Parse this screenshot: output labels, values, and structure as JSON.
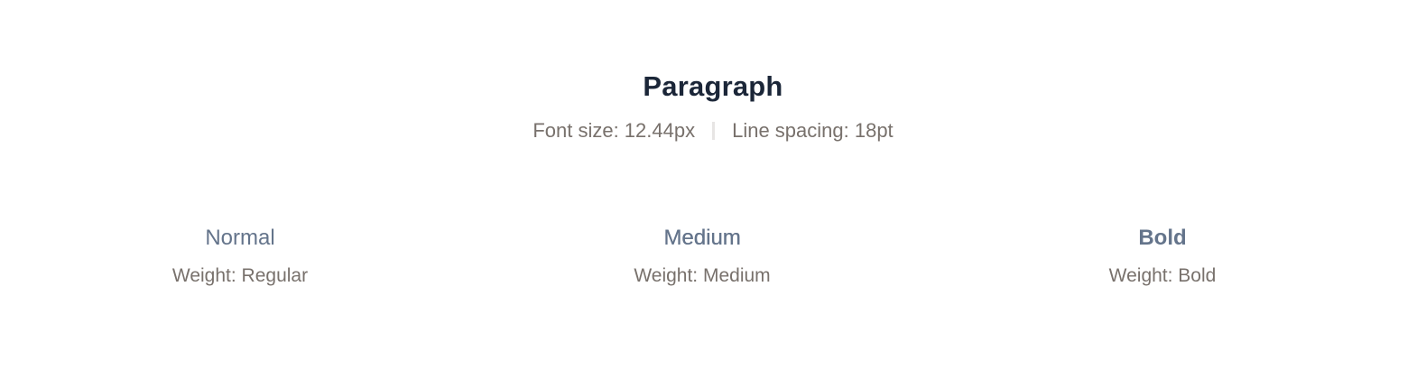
{
  "header": {
    "title": "Paragraph",
    "font_size": "Font size: 12.44px",
    "line_spacing": "Line spacing: 18pt"
  },
  "variants": [
    {
      "name": "Normal",
      "weight": "Weight: Regular"
    },
    {
      "name": "Medium",
      "weight": "Weight: Medium"
    },
    {
      "name": "Bold",
      "weight": "Weight: Bold"
    }
  ],
  "colors": {
    "title": "#1b2638",
    "meta_text": "#78716c",
    "variant_name": "#64748b",
    "divider": "#e7e5e4",
    "background": "#ffffff"
  }
}
